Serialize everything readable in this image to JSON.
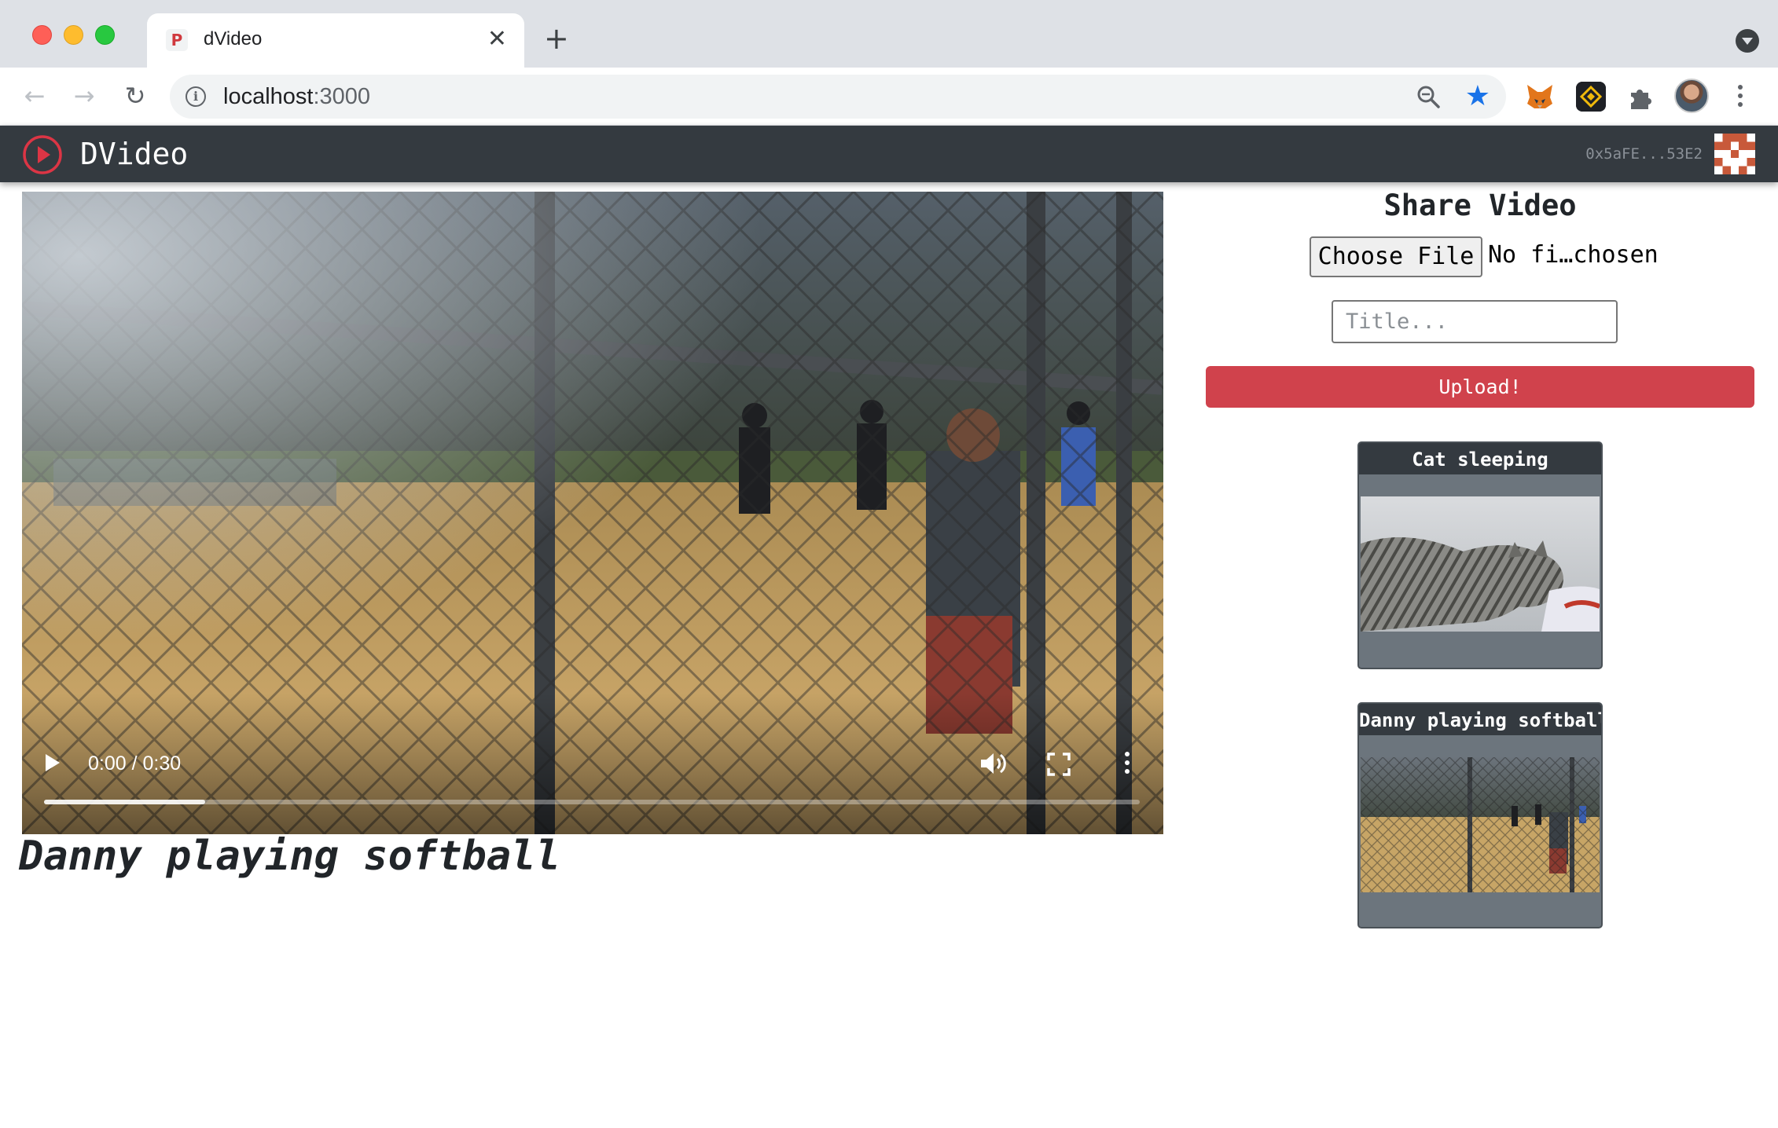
{
  "browser": {
    "tab_title": "dVideo",
    "tab_favicon": "P",
    "tab_close": "✕",
    "new_tab": "+",
    "url_host": "localhost",
    "url_port": ":3000",
    "back_glyph": "←",
    "forward_glyph": "→",
    "reload_glyph": "↻",
    "star_glyph": "★",
    "accent_color": "#1a73e8",
    "icons": [
      "info-icon",
      "zoom-icon",
      "bookmark-star-icon",
      "metamask-fox-icon",
      "binance-icon",
      "extensions-puzzle-icon",
      "profile-avatar",
      "chrome-menu-icon"
    ]
  },
  "navbar": {
    "brand": "DVideo",
    "account": "0x5aFE...53E2",
    "brand_icon": "play-circle-icon",
    "brand_color": "#dc3545"
  },
  "player": {
    "time_display": "0:00 / 0:30",
    "progress_fraction": 0.147,
    "icons": [
      "play-icon",
      "volume-icon",
      "fullscreen-icon",
      "more-options-icon"
    ]
  },
  "current_video": {
    "title": "Danny playing softball"
  },
  "share": {
    "heading": "Share Video",
    "choose_file_label": "Choose File",
    "file_status": "No fi…chosen",
    "title_placeholder": "Title...",
    "upload_label": "Upload!",
    "upload_color": "#d0424c"
  },
  "videos": [
    {
      "title": "Cat sleeping",
      "thumb": "cat-thumbnail"
    },
    {
      "title": "Danny playing softball",
      "thumb": "softball-thumbnail"
    }
  ]
}
